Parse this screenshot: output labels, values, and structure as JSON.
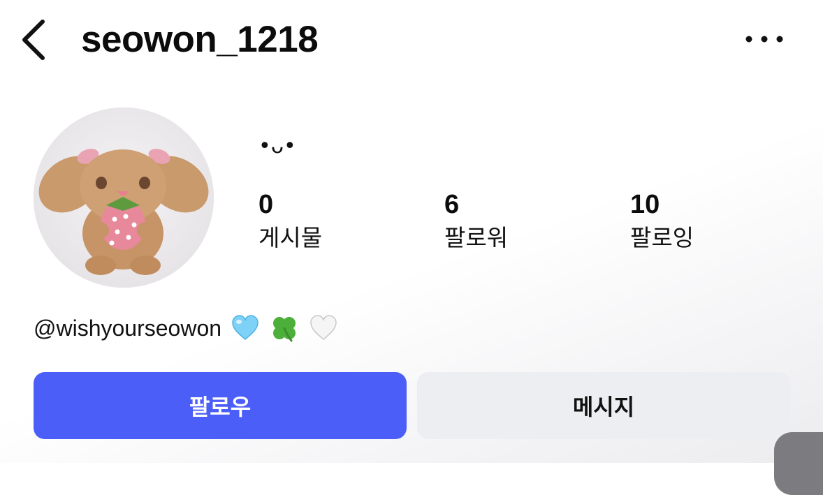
{
  "header": {
    "username": "seowon_1218",
    "back_icon": "chevron-left-icon",
    "more_icon": "more-horizontal-icon"
  },
  "profile": {
    "avatar": "plush-bunny-with-strawberry-avatar",
    "status": "•ᴗ•",
    "stats": [
      {
        "value": "0",
        "label": "게시물"
      },
      {
        "value": "6",
        "label": "팔로워"
      },
      {
        "value": "10",
        "label": "팔로잉"
      }
    ],
    "bio_handle": "@wishyourseowon",
    "bio_emojis": [
      "light-blue-heart-icon",
      "four-leaf-clover-icon",
      "white-heart-icon"
    ]
  },
  "actions": {
    "follow_label": "팔로우",
    "message_label": "메시지"
  },
  "colors": {
    "follow_button": "#4c5ef8",
    "message_button": "#eceef1",
    "text": "#111111"
  }
}
